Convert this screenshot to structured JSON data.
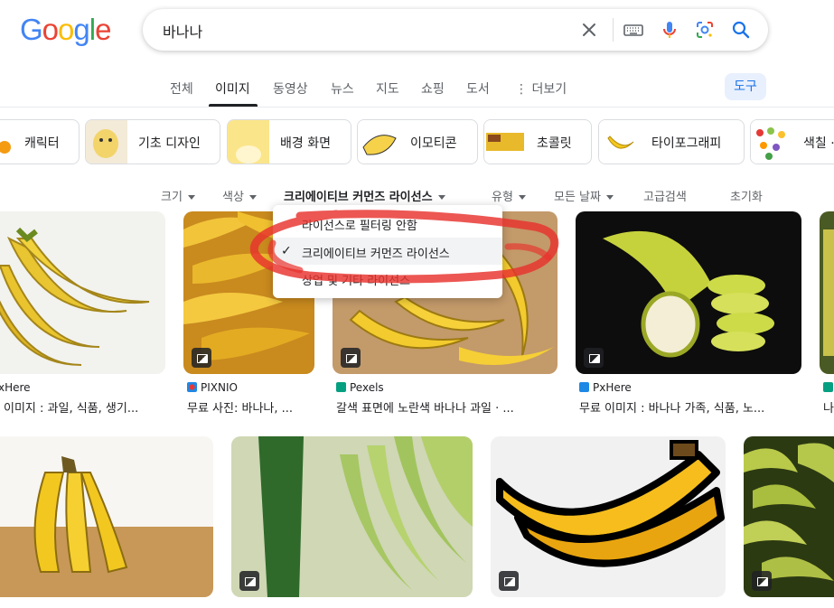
{
  "logo": {
    "letters": [
      "G",
      "o",
      "o",
      "g",
      "l",
      "e"
    ],
    "colors": [
      "#4285f4",
      "#ea4335",
      "#fbbc05",
      "#4285f4",
      "#34a853",
      "#ea4335"
    ]
  },
  "search": {
    "query": "바나나"
  },
  "icons": {
    "clear": "close-icon",
    "keyboard": "keyboard-icon",
    "voice": "mic-icon",
    "lens": "lens-icon",
    "search": "search-icon"
  },
  "tabs": [
    {
      "label": "전체"
    },
    {
      "label": "이미지"
    },
    {
      "label": "동영상"
    },
    {
      "label": "뉴스"
    },
    {
      "label": "지도"
    },
    {
      "label": "쇼핑"
    },
    {
      "label": "도서"
    },
    {
      "label": "더보기"
    }
  ],
  "tools_label": "도구",
  "chips": [
    {
      "label": "캐릭터"
    },
    {
      "label": "기초 디자인"
    },
    {
      "label": "배경 화면"
    },
    {
      "label": "이모티콘"
    },
    {
      "label": "초콜릿"
    },
    {
      "label": "타이포그래피"
    },
    {
      "label": "색칠 ·"
    }
  ],
  "filters": [
    {
      "label": "크기"
    },
    {
      "label": "색상"
    },
    {
      "label": "크리에이티브 커먼즈 라이선스"
    },
    {
      "label": "유형"
    },
    {
      "label": "모든 날짜"
    },
    {
      "label": "고급검색"
    },
    {
      "label": "초기화"
    }
  ],
  "license_menu": {
    "items": [
      {
        "label": "라이선스로 필터링 안함"
      },
      {
        "label": "크리에이티브 커먼즈 라이선스",
        "selected": true
      },
      {
        "label": "상업 및 기타 라이선스"
      }
    ]
  },
  "results_row1": [
    {
      "source": "xHere",
      "caption": "이미지 : 과일, 식품, 생기..."
    },
    {
      "source": "PIXNIO",
      "caption": "무료 사진: 바나나, ..."
    },
    {
      "source": "Pexels",
      "caption": "갈색 표면에 노란색 바나나 과일 · ..."
    },
    {
      "source": "PxHere",
      "caption": "무료 이미지 : 바나나 가족, 식품, 노..."
    },
    {
      "source": "",
      "caption": "나"
    }
  ],
  "accent_colors": {
    "brand_blue": "#1a73e8",
    "annotation_red": "#e8322d",
    "banana_yellow": "#f2c81f"
  }
}
